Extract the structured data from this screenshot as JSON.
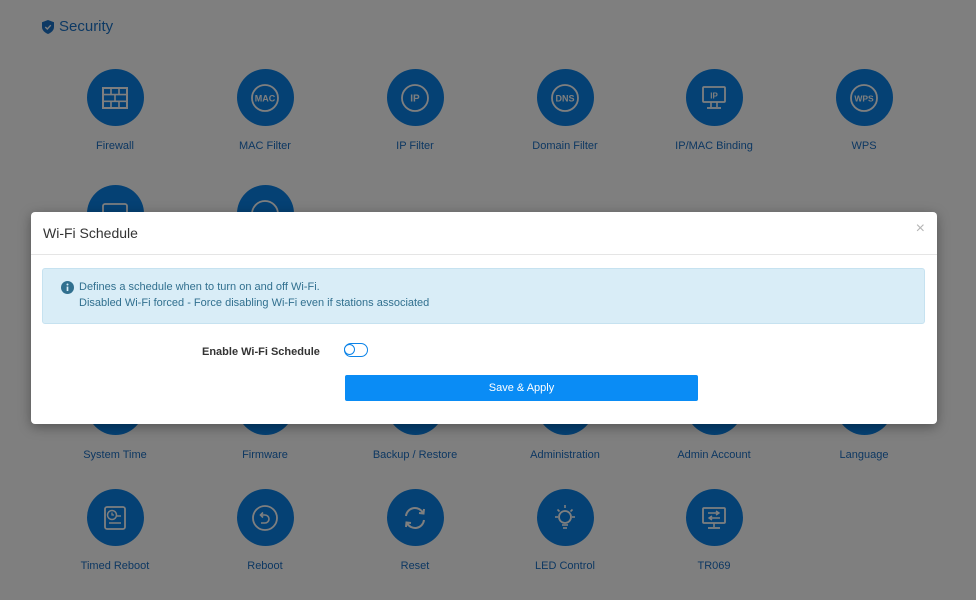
{
  "section": {
    "title": "Security"
  },
  "tiles": {
    "row1": [
      {
        "label": "Firewall"
      },
      {
        "label": "MAC Filter"
      },
      {
        "label": "IP Filter"
      },
      {
        "label": "Domain Filter"
      },
      {
        "label": "IP/MAC Binding"
      },
      {
        "label": "WPS"
      }
    ],
    "row3": [
      {
        "label": "System Time"
      },
      {
        "label": "Firmware"
      },
      {
        "label": "Backup / Restore"
      },
      {
        "label": "Administration"
      },
      {
        "label": "Admin Account"
      },
      {
        "label": "Language"
      }
    ],
    "row4": [
      {
        "label": "Timed Reboot"
      },
      {
        "label": "Reboot"
      },
      {
        "label": "Reset"
      },
      {
        "label": "LED Control"
      },
      {
        "label": "TR069"
      }
    ]
  },
  "icons": {
    "mac": "MAC",
    "ip": "IP",
    "dns": "DNS",
    "ipmac": "IP",
    "wps": "WPS"
  },
  "modal": {
    "title": "Wi-Fi Schedule",
    "close": "×",
    "info_line1": "Defines a schedule when to turn on and off Wi-Fi.",
    "info_line2": "Disabled Wi-Fi forced - Force disabling Wi-Fi even if stations associated",
    "enable_label": "Enable Wi-Fi Schedule",
    "enable_value": false,
    "save_label": "Save & Apply"
  },
  "colors": {
    "accent": "#0b83e8",
    "link": "#1a6fc4",
    "info_bg": "#d9edf7",
    "info_text": "#31708f"
  }
}
